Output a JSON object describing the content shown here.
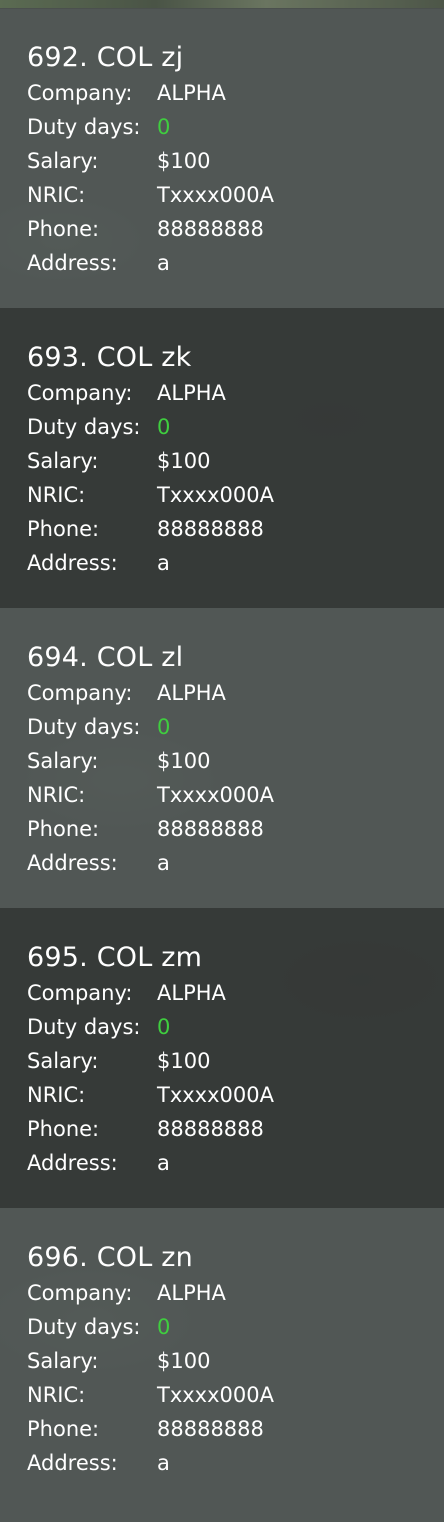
{
  "labels": {
    "company": "Company:",
    "duty_days": "Duty days:",
    "salary": "Salary:",
    "nric": "NRIC:",
    "phone": "Phone:",
    "address": "Address:"
  },
  "persons": [
    {
      "title": "692. COL zj",
      "company": "ALPHA",
      "duty_days": "0",
      "salary": "$100",
      "nric": "Txxxx000A",
      "phone": "88888888",
      "address": "a"
    },
    {
      "title": "693. COL zk",
      "company": "ALPHA",
      "duty_days": "0",
      "salary": "$100",
      "nric": "Txxxx000A",
      "phone": "88888888",
      "address": "a"
    },
    {
      "title": "694. COL zl",
      "company": "ALPHA",
      "duty_days": "0",
      "salary": "$100",
      "nric": "Txxxx000A",
      "phone": "88888888",
      "address": "a"
    },
    {
      "title": "695. COL zm",
      "company": "ALPHA",
      "duty_days": "0",
      "salary": "$100",
      "nric": "Txxxx000A",
      "phone": "88888888",
      "address": "a"
    },
    {
      "title": "696. COL zn",
      "company": "ALPHA",
      "duty_days": "0",
      "salary": "$100",
      "nric": "Txxxx000A",
      "phone": "88888888",
      "address": "a"
    }
  ],
  "colors": {
    "duty_days_value": "#3fce3f",
    "card_light": "#5f6664",
    "card_dark": "#343736"
  }
}
